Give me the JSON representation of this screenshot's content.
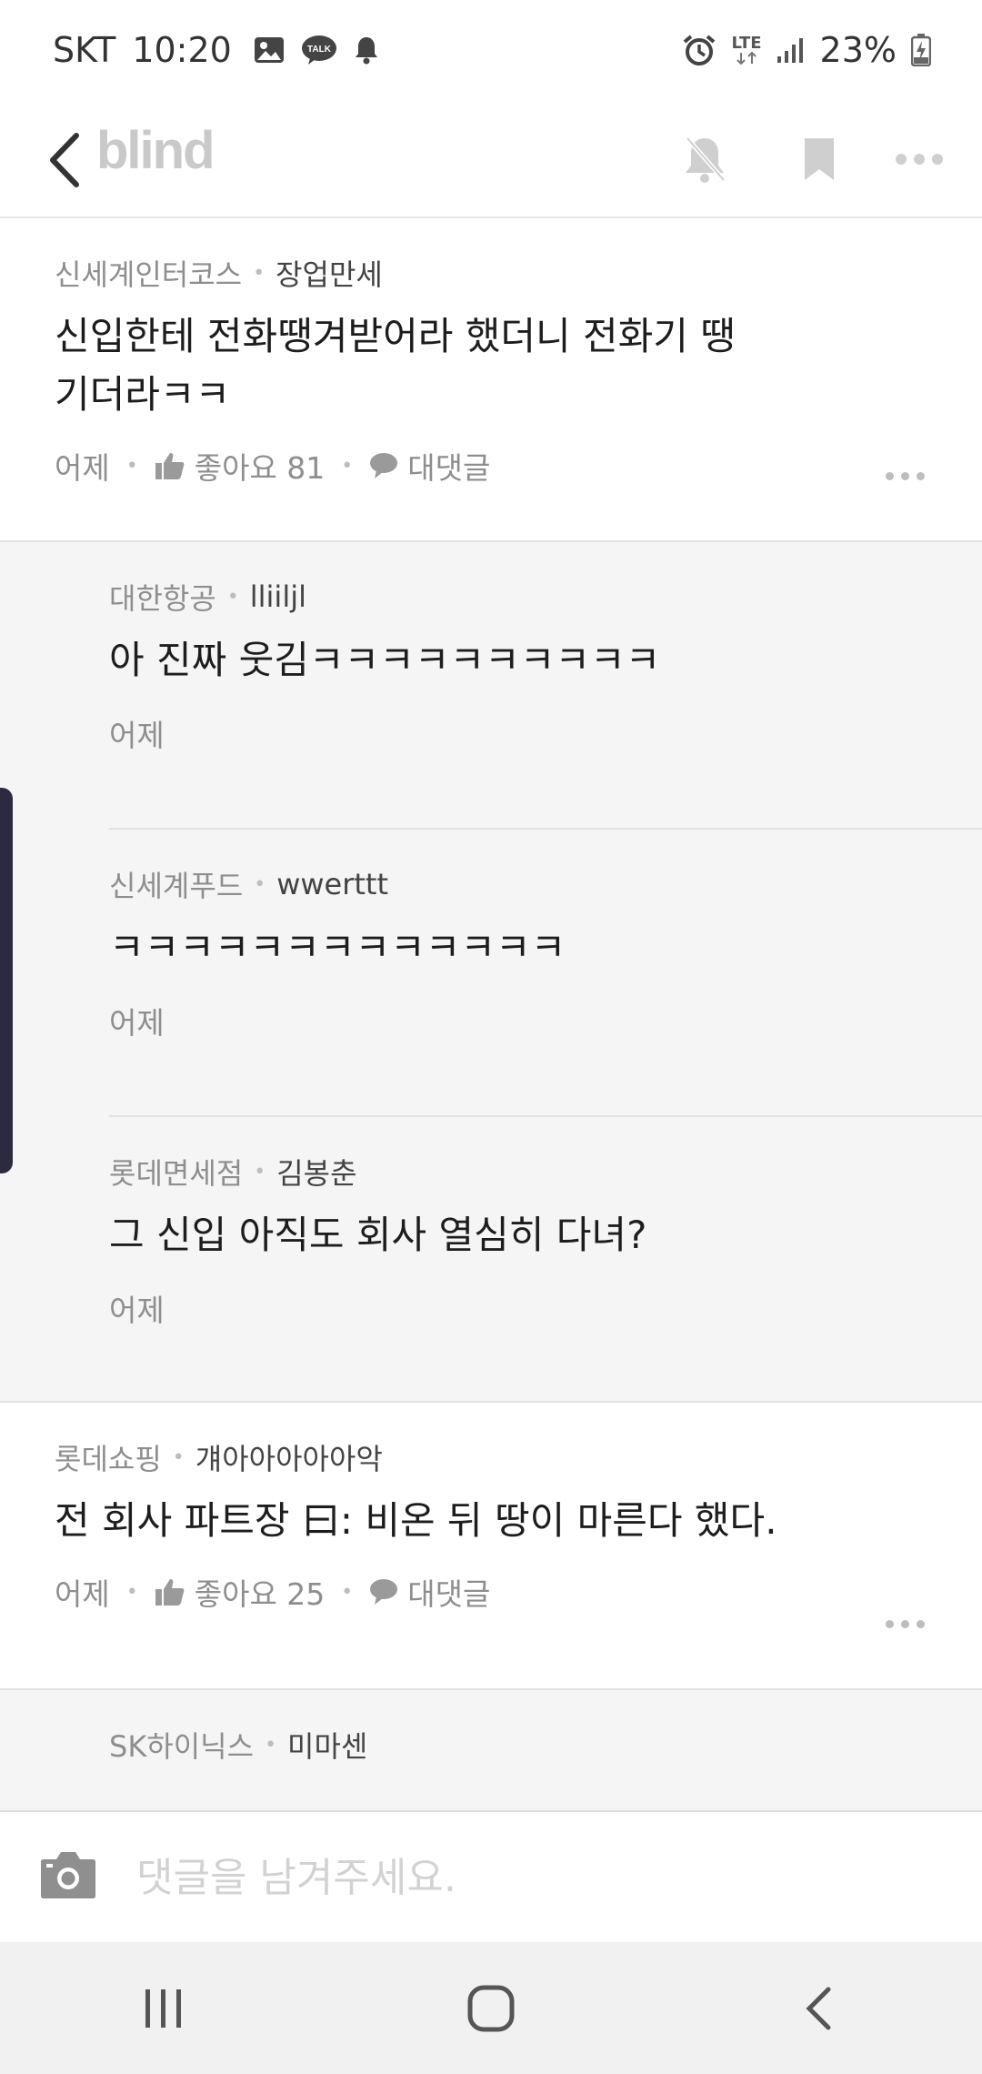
{
  "status_bar": {
    "carrier": "SKT",
    "time": "10:20",
    "network": "LTE",
    "battery": "23%"
  },
  "app_bar": {
    "brand": "blind"
  },
  "comments": [
    {
      "company": "신세계인터코스",
      "nickname": "장업만세",
      "text": "신입한테 전화땡겨받어라 했더니 전화기 땡기더라ㅋㅋ",
      "date": "어제",
      "like_label": "좋아요 81",
      "reply_label": "대댓글",
      "replies": [
        {
          "company": "대한항공",
          "nickname": "lliiljl",
          "text": "아 진짜 웃김ㅋㅋㅋㅋㅋㅋㅋㅋㅋㅋ",
          "date": "어제"
        },
        {
          "company": "신세계푸드",
          "nickname": "wwerttt",
          "text": "ㅋㅋㅋㅋㅋㅋㅋㅋㅋㅋㅋㅋㅋ",
          "date": "어제"
        },
        {
          "company": "롯데면세점",
          "nickname": "김봉춘",
          "text": "그 신입 아직도 회사 열심히 다녀?",
          "date": "어제"
        }
      ]
    },
    {
      "company": "롯데쇼핑",
      "nickname": "걔아아아아아악",
      "text": "전 회사 파트장 曰: 비온 뒤 땅이 마른다 했다.",
      "date": "어제",
      "like_label": "좋아요 25",
      "reply_label": "대댓글",
      "replies": [
        {
          "company": "SK하이닉스",
          "nickname": "미마센",
          "text": ""
        }
      ]
    }
  ],
  "input": {
    "placeholder": "댓글을 남겨주세요."
  }
}
